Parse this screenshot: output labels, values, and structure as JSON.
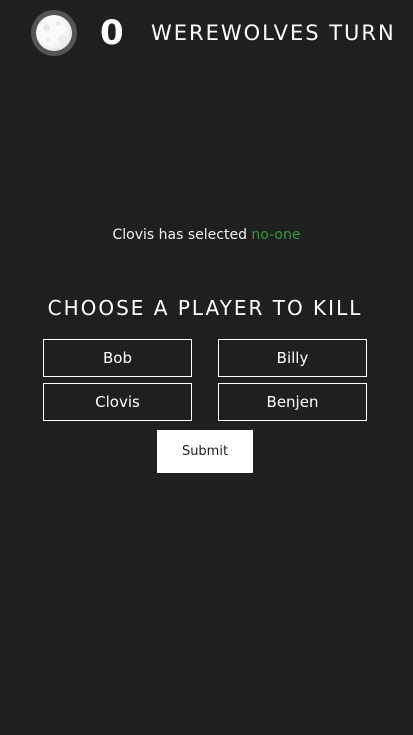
{
  "header": {
    "counter": "0",
    "turn_title": "WEREWOLVES TURN",
    "moon_icon": "full-moon-icon"
  },
  "selection": {
    "player": "Clovis",
    "middle": "has selected",
    "value": "no-one",
    "value_color": "#2e9c3a"
  },
  "prompt": {
    "heading": "CHOOSE A PLAYER TO KILL"
  },
  "players": [
    {
      "name": "Bob"
    },
    {
      "name": "Billy"
    },
    {
      "name": "Clovis"
    },
    {
      "name": "Benjen"
    }
  ],
  "submit": {
    "label": "Submit"
  },
  "colors": {
    "background": "#1f1f1f",
    "text": "#ffffff",
    "accent_green": "#2e9c3a"
  }
}
